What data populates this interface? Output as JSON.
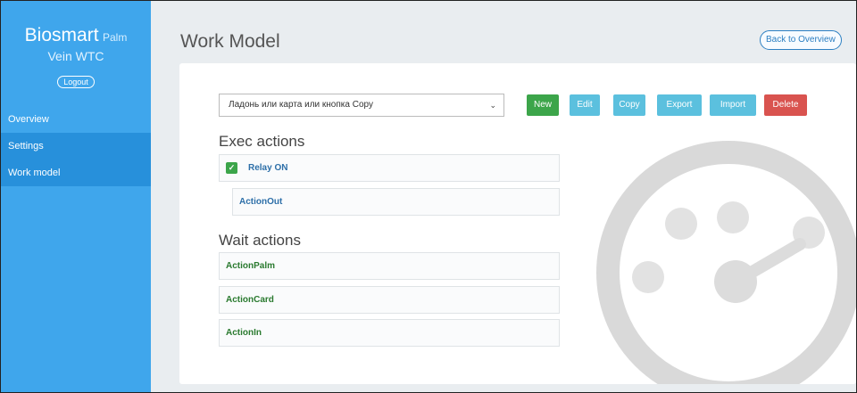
{
  "sidebar": {
    "brand_main": "Biosmart",
    "brand_sub": "Palm",
    "brand_line2": "Vein WTC",
    "logout_label": "Logout",
    "items": [
      {
        "label": "Overview"
      },
      {
        "label": "Settings"
      },
      {
        "label": "Work model"
      }
    ],
    "color": "#3fa6ec",
    "active_color": "#2790db"
  },
  "header": {
    "title": "Work Model",
    "back_label": "Back to Overview"
  },
  "toolbar": {
    "select_value": "Ладонь или карта или кнопка Copy",
    "new_label": "New",
    "edit_label": "Edit",
    "copy_label": "Copy",
    "export_label": "Export",
    "import_label": "Import",
    "delete_label": "Delete"
  },
  "exec": {
    "title": "Exec actions",
    "items": [
      {
        "label": "Relay ON"
      },
      {
        "label": "ActionOut"
      }
    ]
  },
  "wait": {
    "title": "Wait actions",
    "items": [
      {
        "label": "ActionPalm"
      },
      {
        "label": "ActionCard"
      },
      {
        "label": "ActionIn"
      }
    ]
  },
  "colors": {
    "success": "#3ca54a",
    "info": "#5bc0de",
    "danger": "#d9534f"
  }
}
